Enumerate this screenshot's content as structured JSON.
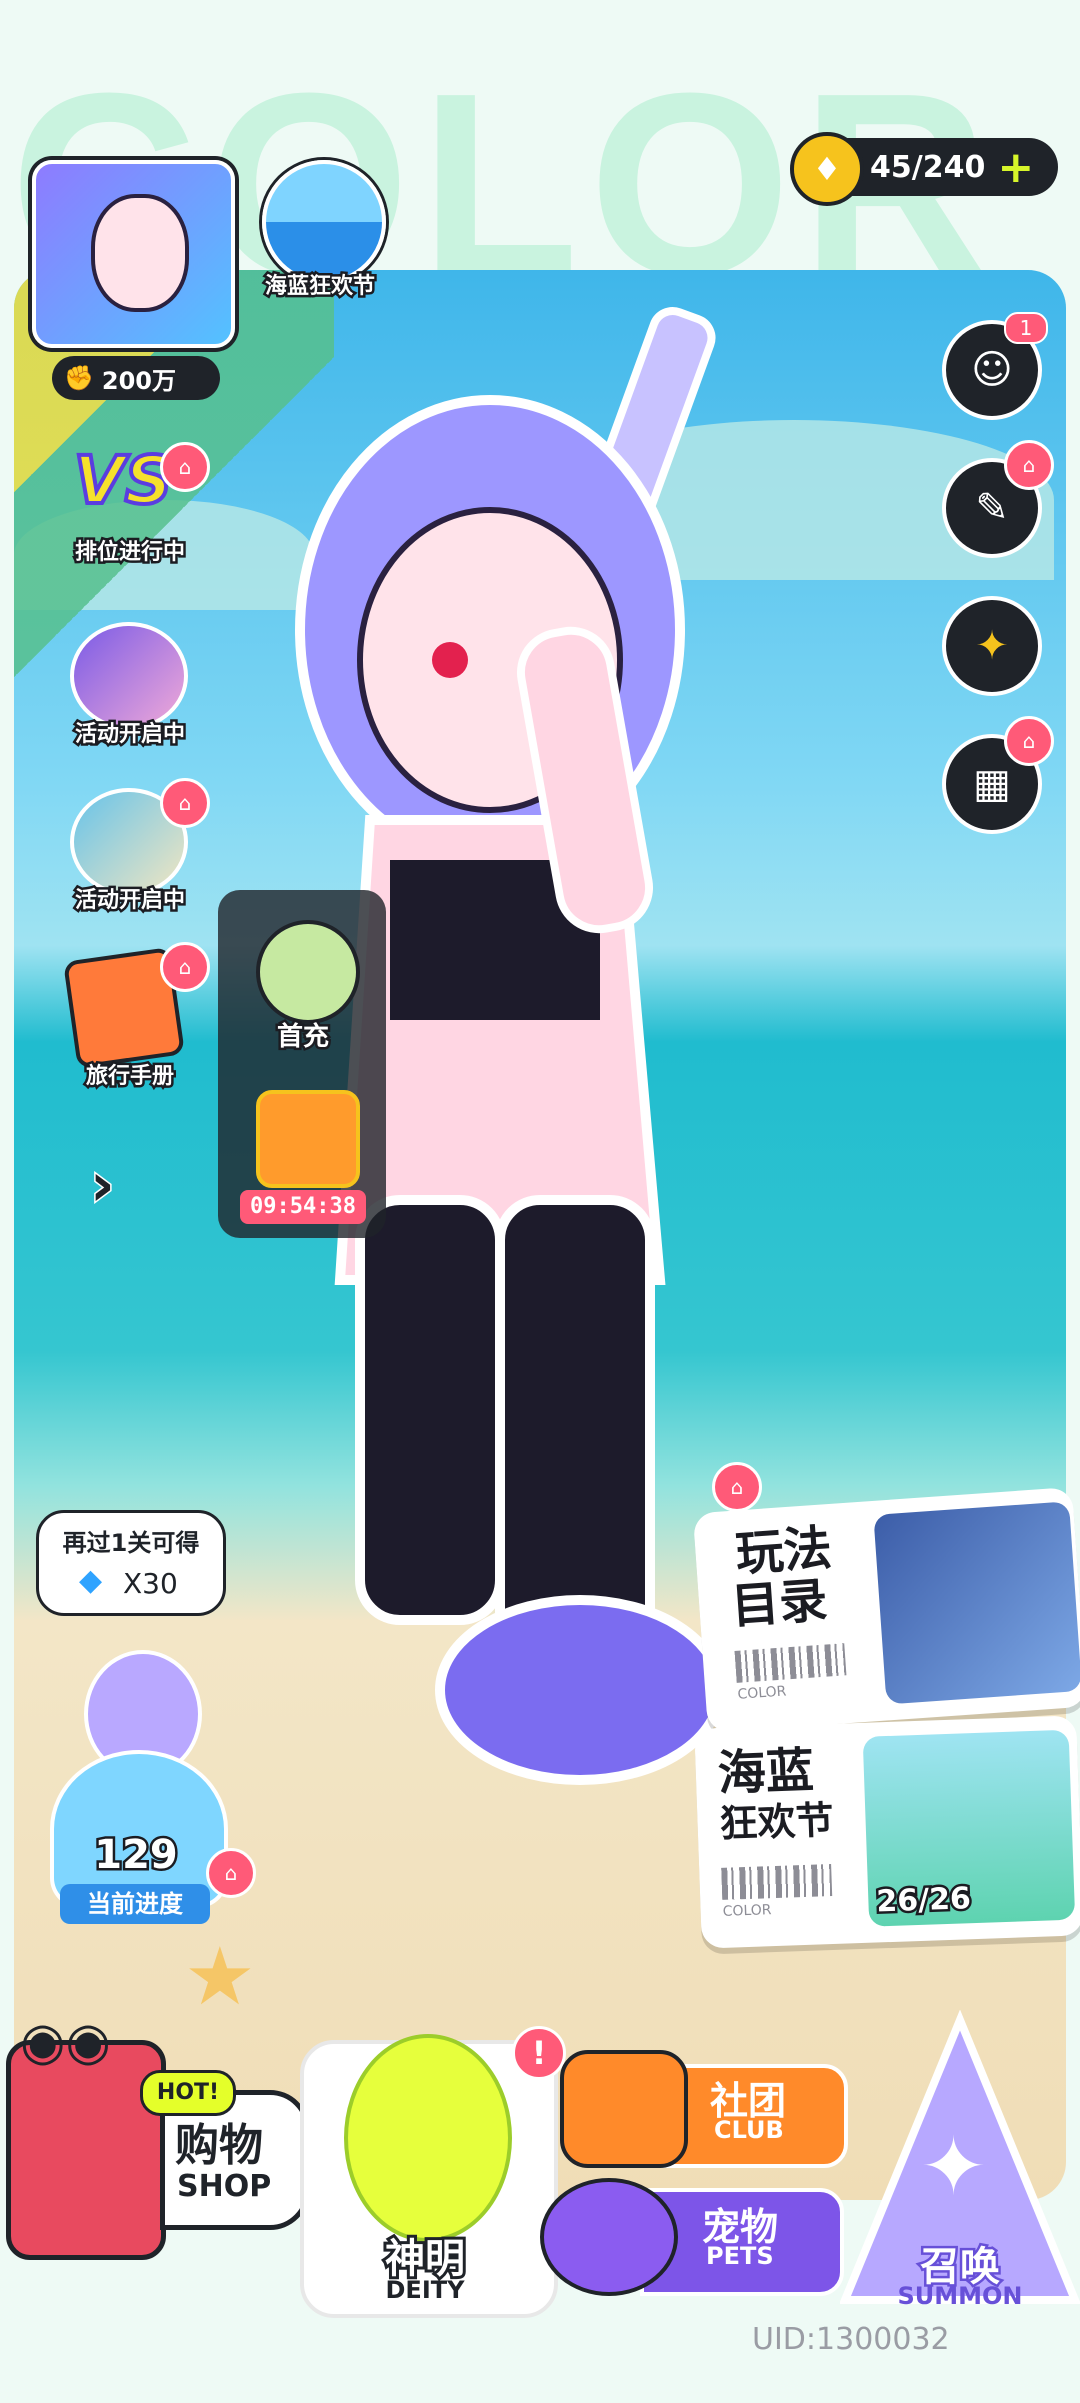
{
  "background_word": "COLOR",
  "player": {
    "power_value": "200万"
  },
  "event_badge": {
    "label": "海蓝狂欢节"
  },
  "currency": {
    "value": "45/240",
    "add_symbol": "+"
  },
  "left_menu": [
    {
      "label": "排位进行中",
      "icon": "vs-icon"
    },
    {
      "label": "活动开启中",
      "icon": "event-icon"
    },
    {
      "label": "活动开启中",
      "icon": "event-icon"
    },
    {
      "label": "旅行手册",
      "icon": "book-icon"
    }
  ],
  "promo_panel": {
    "first_charge_label": "首充",
    "timer": "09:54:38"
  },
  "right_menu": {
    "notification_count": "1"
  },
  "progress_reward": {
    "hint": "再过1关可得",
    "reward": "X30",
    "level": "129",
    "label": "当前进度"
  },
  "cards": {
    "gameplay": {
      "title_line1": "玩法",
      "title_line2": "目录",
      "brand": "COLOR"
    },
    "festival": {
      "title_line1": "海蓝",
      "title_line2": "狂欢节",
      "brand": "COLOR",
      "progress": "26/26"
    }
  },
  "bottom_nav": {
    "shop": {
      "cn": "购物",
      "en": "SHOP",
      "badge": "HOT!"
    },
    "deity": {
      "cn": "神明",
      "en": "DEITY",
      "alert": "!"
    },
    "club": {
      "cn": "社团",
      "en": "CLUB"
    },
    "pets": {
      "cn": "宠物",
      "en": "PETS"
    },
    "summon": {
      "cn": "召唤",
      "en": "SUMMON"
    }
  },
  "uid": "UID:1300032",
  "colors": {
    "dark": "#1f2329",
    "accent_yellow": "#f6c31d",
    "plus_green": "#d7f52a",
    "gift_red": "#ff5a78",
    "club_orange": "#ff8a2a",
    "pets_purple": "#7d55e8",
    "summon_purple": "#8f7bf0"
  }
}
